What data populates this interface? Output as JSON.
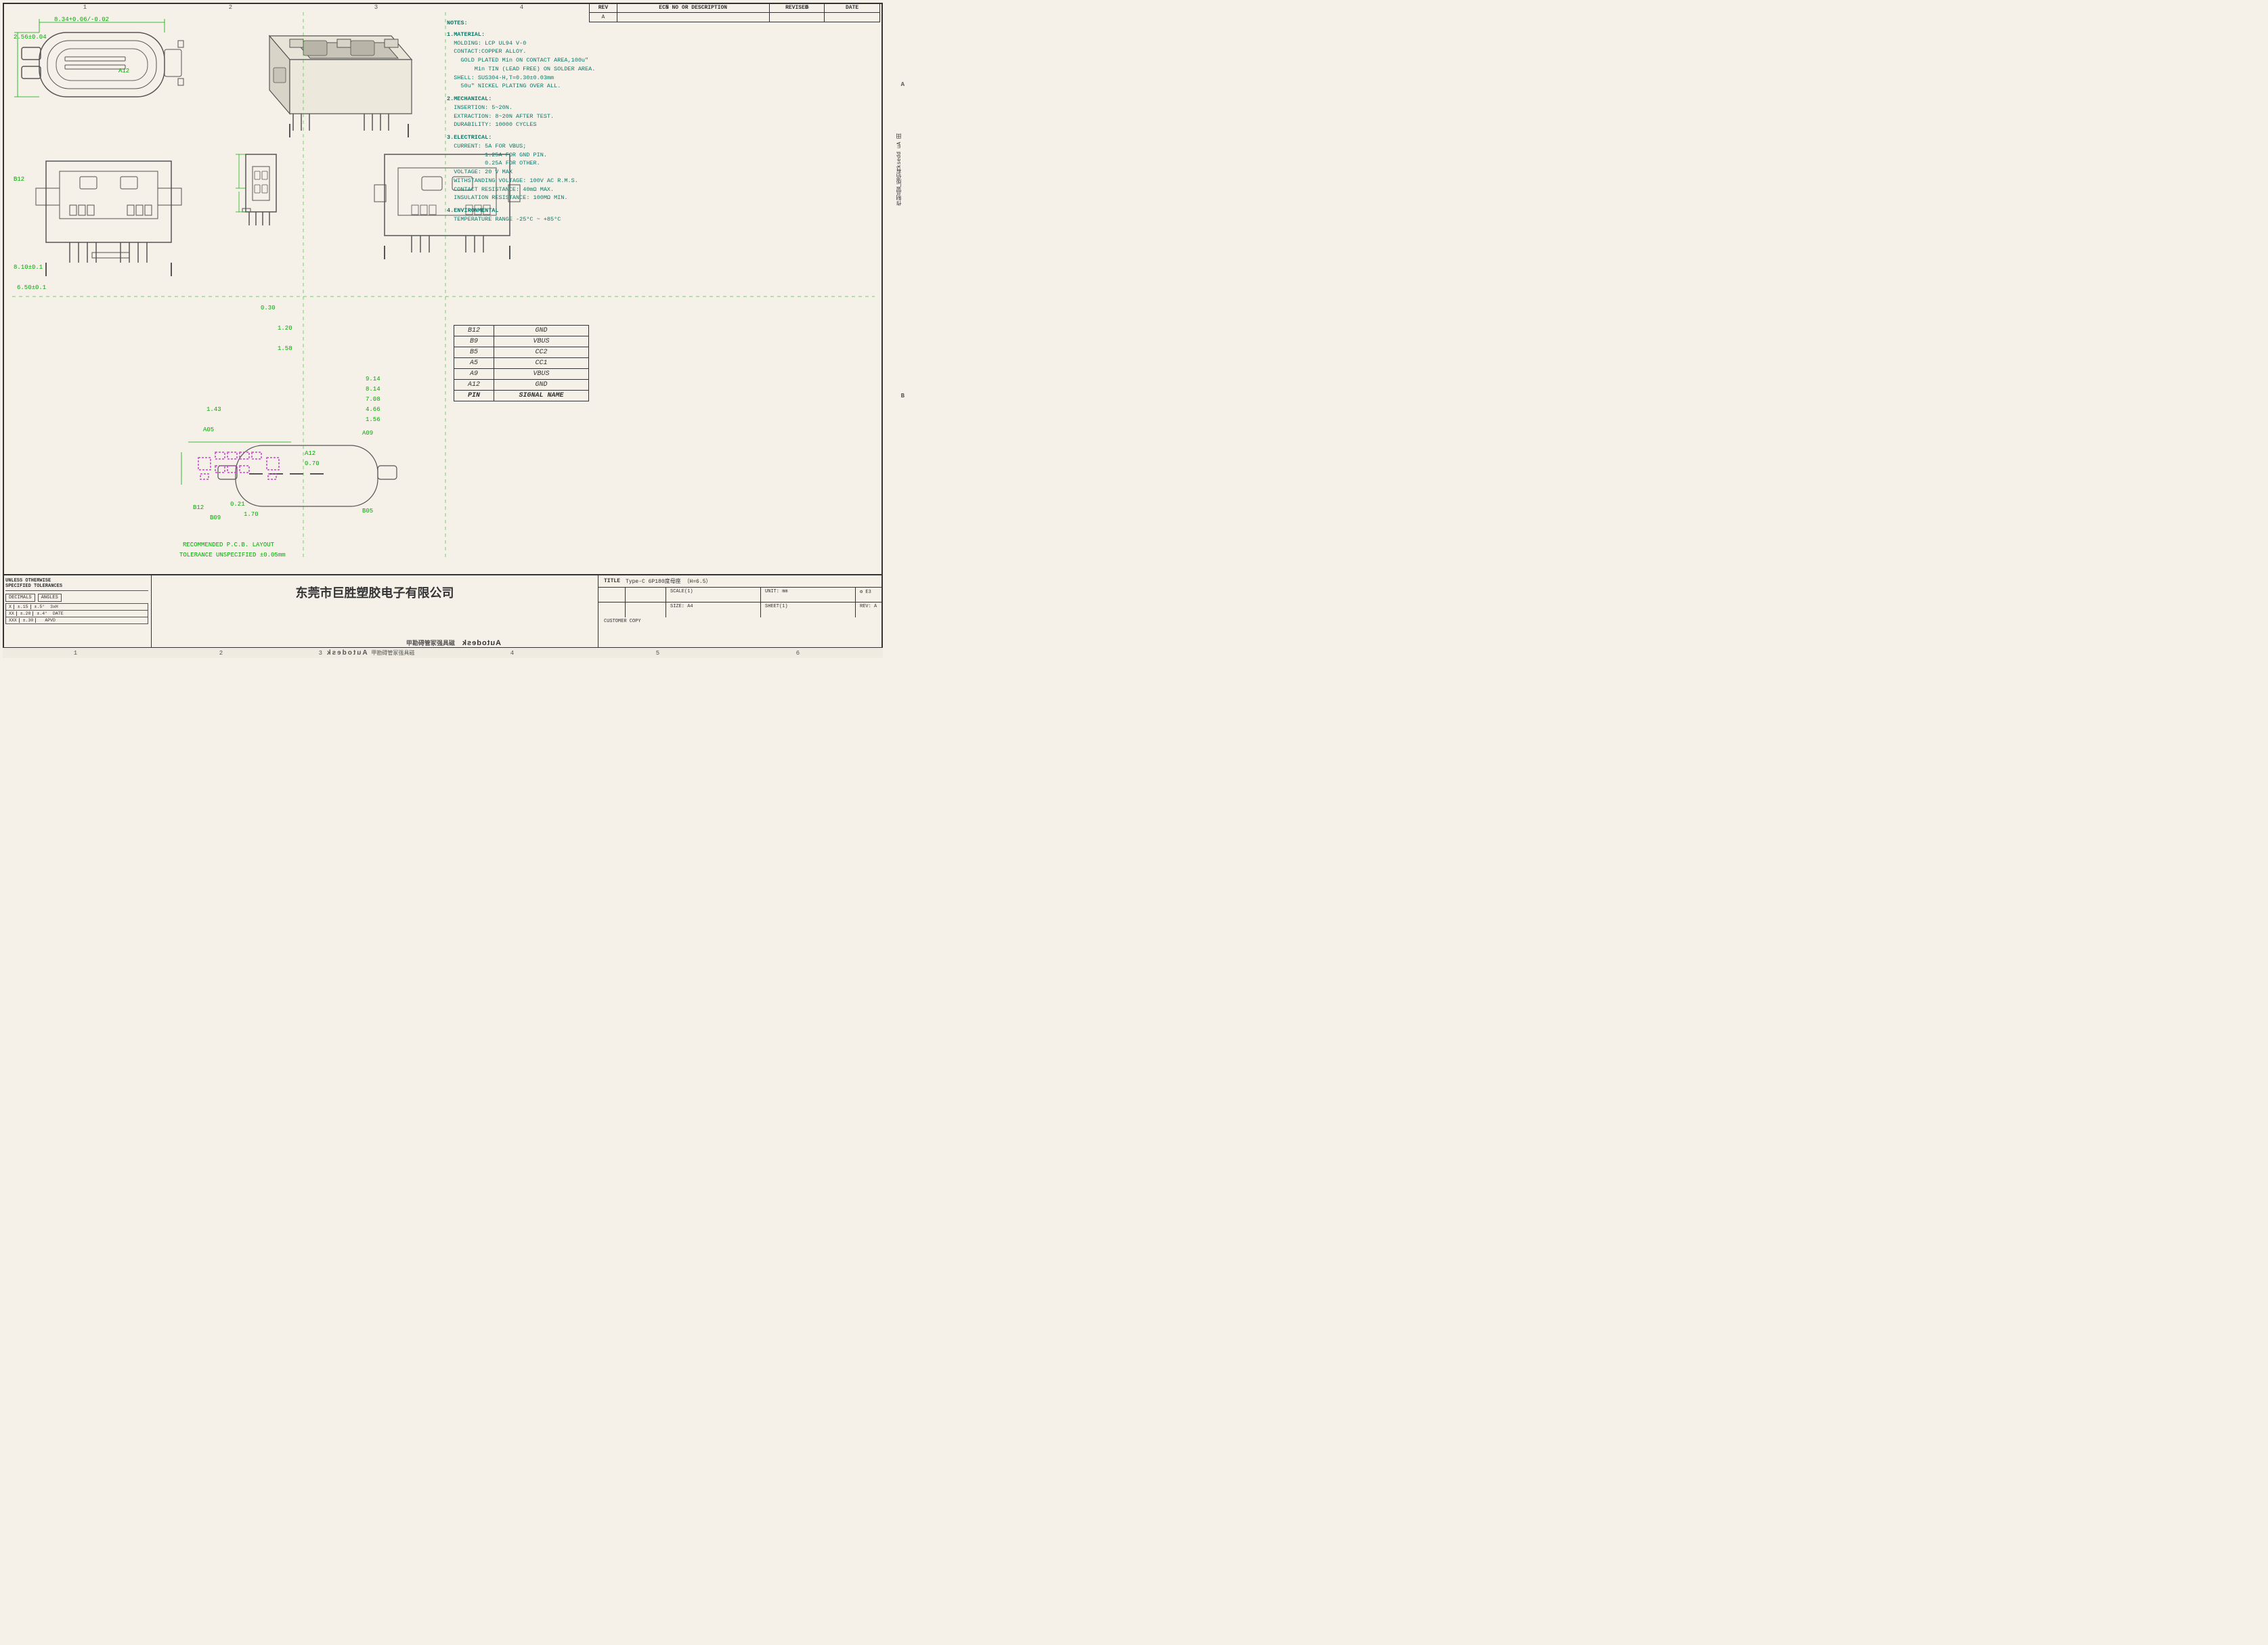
{
  "title": "Type-C 6P180度母座 (H=6.5)",
  "company": "东莞市巨胜塑胶电子有限公司",
  "drawing": {
    "grid_cols": [
      "1",
      "2",
      "3",
      "4",
      "5",
      "6"
    ],
    "grid_rows": [
      "A",
      "B"
    ],
    "rev_table": {
      "headers": [
        "REV",
        "ECN NO OR DESCRIPTION",
        "REVISED",
        "DATE"
      ],
      "rows": [
        [
          "A",
          "",
          "",
          ""
        ]
      ]
    }
  },
  "notes": {
    "title": "NOTES:",
    "items": [
      {
        "num": "1",
        "title": "MATERIAL:",
        "sub": [
          "MOLDING: LCP UL94 V-0",
          "CONTACT:COPPER ALLOY.",
          "    GOLD PLATED Min ON CONTACT AREA,100u\"",
          "        Min TIN (LEAD FREE) ON SOLDER AREA.",
          "SHELL: SUS304-H,T=0.30±0.03mm",
          "    50u\" NICKEL PLATING OVER ALL."
        ]
      },
      {
        "num": "2",
        "title": "MECHANICAL:",
        "sub": [
          "INSERTION: 5~20N.",
          "EXTRACTION: 8~20N AFTER TEST.",
          "DURABILITY: 10000 CYCLES"
        ]
      },
      {
        "num": "3",
        "title": "ELECTRICAL:",
        "sub": [
          "CURRENT: 5A FOR VBUS;",
          "    1.25A FOR GND PIN.",
          "    0.25A FOR OTHER.",
          "VOLTAGE: 20 V MAX",
          "WITHSTANDING VOLTAGE: 100V AC R.M.S.",
          "CONTACT RESISTANCE: 40mΩ MAX.",
          "INSULATION RESISTANCE: 100MΩ MIN."
        ]
      },
      {
        "num": "4",
        "title": "ENVIRONMENTAL",
        "sub": [
          "TEMPERATURE RANGE -25°C ~ +85°C"
        ]
      }
    ]
  },
  "pin_table": {
    "headers": [
      "PIN",
      "SIGNAL NAME"
    ],
    "rows": [
      [
        "B12",
        "GND"
      ],
      [
        "B9",
        "VBUS"
      ],
      [
        "B5",
        "CC2"
      ],
      [
        "A5",
        "CC1"
      ],
      [
        "A9",
        "VBUS"
      ],
      [
        "A12",
        "GND"
      ]
    ]
  },
  "dimensions": {
    "top_view": {
      "width": "8.34+0.06/-0.02",
      "height": "2.56±0.04",
      "label_a12": "A12",
      "label_b12": "B12"
    },
    "front_view": {
      "width1": "8.10±0.1",
      "width2": "6.50±0.1"
    },
    "dim_030": "0.30",
    "dim_120": "1.20",
    "dim_158": "1.58",
    "pcb_dims": {
      "d1": "9.14",
      "d2": "8.14",
      "d3": "7.08",
      "d4": "4.66",
      "d5": "1.56",
      "d6": "1.43",
      "d7": "0.70",
      "d8": "0.21",
      "d9": "1.70",
      "label_a05": "A05",
      "label_a09": "A09",
      "label_a12": "A12",
      "label_b12": "B12",
      "label_b09": "B09",
      "label_b05": "B05"
    }
  },
  "title_block": {
    "unless_otherwise": "UNLESS OTHERWISE",
    "specified_tolerances": "SPECIFIED TOLERANCES",
    "decimals_label": "DECIMALS",
    "angles_label": "ANGLES",
    "tol_rows": [
      {
        "dec": "±.15",
        "x": "X",
        "ang": ".5°",
        "blank": "3xH"
      },
      {
        "dec": "±.20",
        "dec2": "XX",
        "ang2": ".4°",
        "label": "DATE"
      },
      {
        "dec": "±.30",
        "dec2": "XXX",
        "blank": "APVD"
      }
    ],
    "title_label": "TITLE",
    "title_value": "Type-C 6P180度母座 （H=6.5）",
    "scale_label": "SCALE(1)",
    "unit_label": "UNIT: mm",
    "size_label": "SIZE: A4",
    "sheet_label": "SHEET(1)",
    "rev_label": "REV: A",
    "customer_copy": "CUSTOMER COPY",
    "bottom_text": "甲勘碍管冢强具磁"
  },
  "right_side_text": "作制品产版佰有ksedd uA 田",
  "autodesk_text": "Autodesk"
}
